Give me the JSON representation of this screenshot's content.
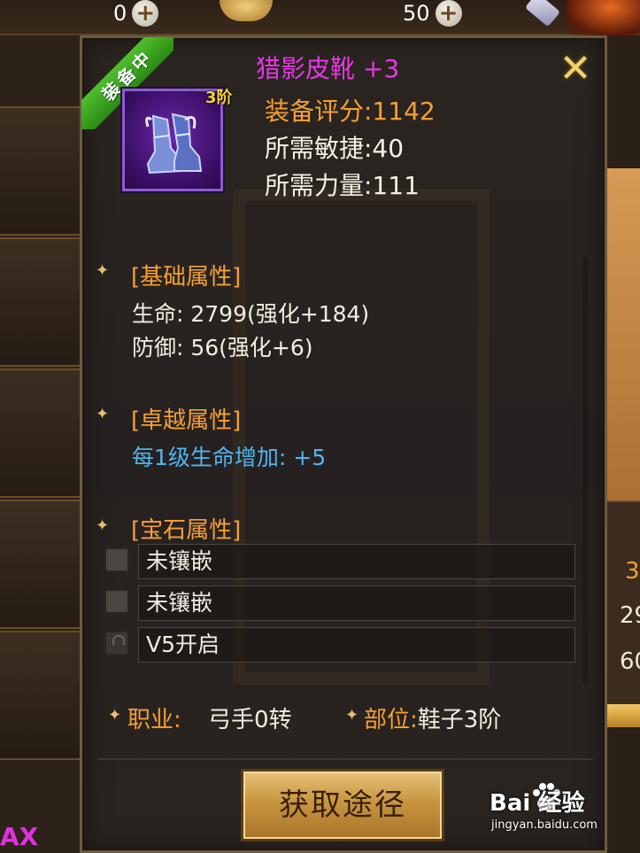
{
  "hud": {
    "currency1_value": "0",
    "currency2_value": "50",
    "plus_symbol": "+"
  },
  "tooltip": {
    "equipped_label": "装备中",
    "close_symbol": "✕",
    "item_name": "猎影皮靴 +3",
    "tier_badge": "3阶",
    "score_line": "装备评分:1142",
    "req_agility": "所需敏捷:40",
    "req_strength": "所需力量:111",
    "sections": {
      "basic_title": "[基础属性]",
      "basic_hp": "生命: 2799(强化+184)",
      "basic_def": "防御: 56(强化+6)",
      "excellent_title": "[卓越属性]",
      "excellent_line": "每1级生命增加: +5",
      "gem_title": "[宝石属性]"
    },
    "gem_slots": [
      "未镶嵌",
      "未镶嵌",
      "V5开启"
    ],
    "class_label": "职业:",
    "class_value": "弓手0转",
    "slot_label": "部位:",
    "slot_value": "鞋子3阶",
    "source_button": "获取途径"
  },
  "background": {
    "left_bottom_text": "AX",
    "right_texts": [
      "3",
      "29",
      "60"
    ]
  },
  "watermark": {
    "main": "Bai  经验",
    "sub": "jingyan.baidu.com"
  },
  "colors": {
    "item_name": "#e638e6",
    "section_title": "#f5a033",
    "excellent_attr": "#4fb5f0",
    "equipped_ribbon": "#3aa81e",
    "button_gold": "#c8953f"
  },
  "icons": {
    "plus": "plus-icon",
    "close": "close-icon",
    "diamond": "diamond-bullet-icon",
    "boots": "boots-item-icon",
    "lock": "lock-icon"
  }
}
